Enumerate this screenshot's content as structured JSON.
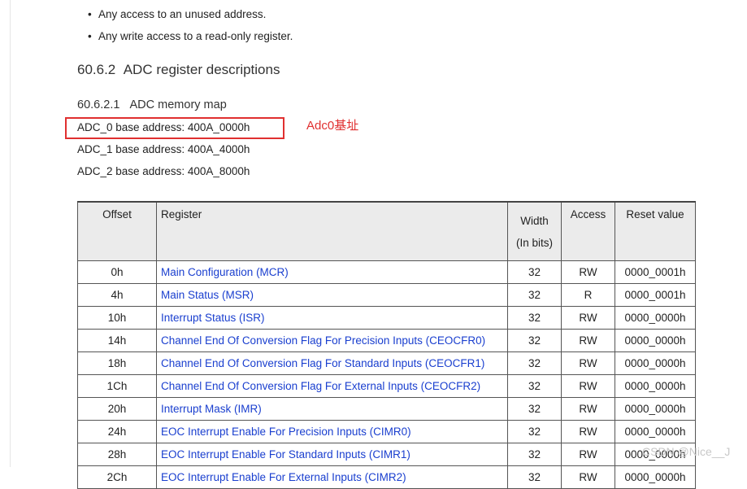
{
  "bullets": [
    "Any access to an unused address.",
    "Any write access to a read-only register."
  ],
  "section": {
    "number": "60.6.2",
    "title": "ADC register descriptions"
  },
  "subsection": {
    "number": "60.6.2.1",
    "title": "ADC memory map"
  },
  "base_addresses": [
    "ADC_0 base address: 400A_0000h",
    "ADC_1 base address: 400A_4000h",
    "ADC_2 base address: 400A_8000h"
  ],
  "annotation": {
    "text": "Adc0基址",
    "color": "#e03030"
  },
  "table": {
    "headers": {
      "offset": "Offset",
      "register": "Register",
      "width_line1": "Width",
      "width_line2": "(In bits)",
      "access": "Access",
      "reset": "Reset value"
    },
    "link_color": "#1a3fcf",
    "rows": [
      {
        "offset": "0h",
        "register": "Main Configuration (MCR)",
        "width": "32",
        "access": "RW",
        "reset": "0000_0001h"
      },
      {
        "offset": "4h",
        "register": "Main Status (MSR)",
        "width": "32",
        "access": "R",
        "reset": "0000_0001h"
      },
      {
        "offset": "10h",
        "register": "Interrupt Status (ISR)",
        "width": "32",
        "access": "RW",
        "reset": "0000_0000h"
      },
      {
        "offset": "14h",
        "register": "Channel End Of Conversion Flag For Precision Inputs (CEOCFR0)",
        "width": "32",
        "access": "RW",
        "reset": "0000_0000h"
      },
      {
        "offset": "18h",
        "register": "Channel End Of Conversion Flag For Standard Inputs (CEOCFR1)",
        "width": "32",
        "access": "RW",
        "reset": "0000_0000h"
      },
      {
        "offset": "1Ch",
        "register": "Channel End Of Conversion Flag For External Inputs (CEOCFR2)",
        "width": "32",
        "access": "RW",
        "reset": "0000_0000h"
      },
      {
        "offset": "20h",
        "register": "Interrupt Mask (IMR)",
        "width": "32",
        "access": "RW",
        "reset": "0000_0000h"
      },
      {
        "offset": "24h",
        "register": "EOC Interrupt Enable For Precision Inputs (CIMR0)",
        "width": "32",
        "access": "RW",
        "reset": "0000_0000h"
      },
      {
        "offset": "28h",
        "register": "EOC Interrupt Enable For Standard Inputs (CIMR1)",
        "width": "32",
        "access": "RW",
        "reset": "0000_0000h"
      },
      {
        "offset": "2Ch",
        "register": "EOC Interrupt Enable For External Inputs (CIMR2)",
        "width": "32",
        "access": "RW",
        "reset": "0000_0000h"
      }
    ]
  },
  "watermark": "CSDN @Nice__J"
}
